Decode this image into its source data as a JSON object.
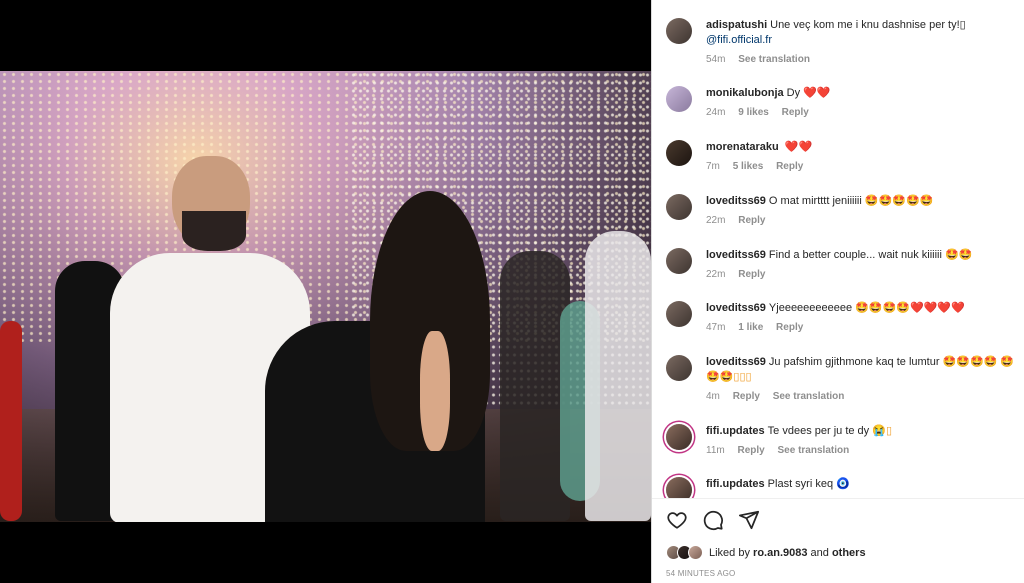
{
  "comments": [
    {
      "user": "adispatushi",
      "text": "Une veç kom me i knu dashnise per ty!▯",
      "mention": "@fifi.official.fr",
      "time": "54m",
      "likes": "",
      "reply": "",
      "translation": "See translation"
    },
    {
      "user": "monikalubonja",
      "text": "Dy",
      "extra": "❤️❤️",
      "time": "24m",
      "likes": "9 likes",
      "reply": "Reply",
      "translation": ""
    },
    {
      "user": "morenataraku",
      "text": "",
      "extra": "❤️❤️",
      "time": "7m",
      "likes": "5 likes",
      "reply": "Reply",
      "translation": ""
    },
    {
      "user": "loveditss69",
      "text": "O mat mirtttt jeniiiiii",
      "extra": "🤩🤩🤩🤩🤩",
      "time": "22m",
      "likes": "",
      "reply": "Reply",
      "translation": ""
    },
    {
      "user": "loveditss69",
      "text": "Find a better couple... wait nuk kiiiiii",
      "extra": "🤩🤩",
      "time": "22m",
      "likes": "",
      "reply": "Reply",
      "translation": ""
    },
    {
      "user": "loveditss69",
      "text": "Yjeeeeeeeeeeee",
      "extra": "🤩🤩🤩🤩❤️❤️❤️❤️",
      "time": "47m",
      "likes": "1 like",
      "reply": "Reply",
      "translation": ""
    },
    {
      "user": "loveditss69",
      "text": "Ju pafshim gjithmone kaq te lumtur",
      "extra": "🤩🤩🤩🤩 🤩🤩🤩▯▯▯",
      "time": "4m",
      "likes": "",
      "reply": "Reply",
      "translation": "See translation"
    },
    {
      "user": "fifi.updates",
      "text": "Te vdees per ju te dy",
      "extra": "😭▯",
      "time": "11m",
      "likes": "",
      "reply": "Reply",
      "translation": "See translation"
    },
    {
      "user": "fifi.updates",
      "text": "Plast syri keq",
      "extra": "🧿",
      "time": "",
      "likes": "",
      "reply": "",
      "translation": ""
    }
  ],
  "likes_bar": {
    "prefix": "Liked by",
    "user": "ro.an.9083",
    "joiner": "and",
    "others": "others"
  },
  "posted_ago": "54 MINUTES AGO",
  "icons": {
    "like": "heart-icon",
    "comment": "comment-icon",
    "share": "share-icon"
  }
}
